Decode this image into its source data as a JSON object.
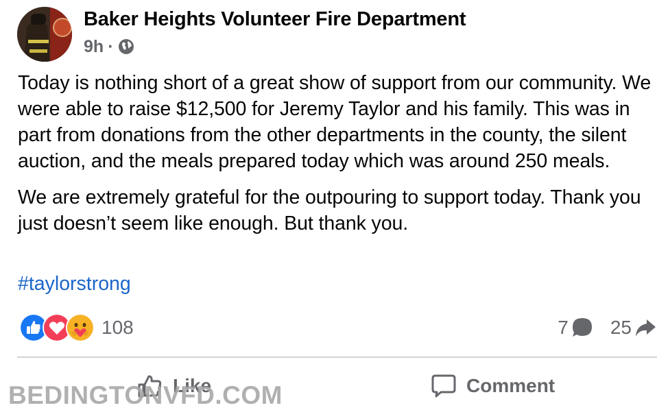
{
  "post": {
    "page_name": "Baker Heights Volunteer Fire Department",
    "time": "9h",
    "separator": "·",
    "audience_icon": "globe-icon",
    "paragraphs": [
      "Today is nothing short of a great show of support from our community. We were able to raise $12,500 for Jeremy Taylor and his family. This was in part from donations from the other departments in the county, the silent auction, and the meals prepared today which was around 250 meals.",
      "We are extremely grateful for the outpouring to support today. Thank you just doesn’t seem like enough. But thank you."
    ],
    "hashtag": "#taylorstrong"
  },
  "stats": {
    "reaction_icons": [
      "like-reaction-icon",
      "love-reaction-icon",
      "care-reaction-icon"
    ],
    "reaction_count": "108",
    "comment_count": "7",
    "share_count": "25"
  },
  "actions": {
    "like_label": "Like",
    "comment_label": "Comment"
  },
  "watermark": "BEDINGTONVFD.COM",
  "colors": {
    "link": "#1b66c9",
    "secondary_text": "#65676b",
    "like_blue": "#1877f2",
    "love_red": "#f33e58",
    "care_yellow": "#f7b125"
  }
}
